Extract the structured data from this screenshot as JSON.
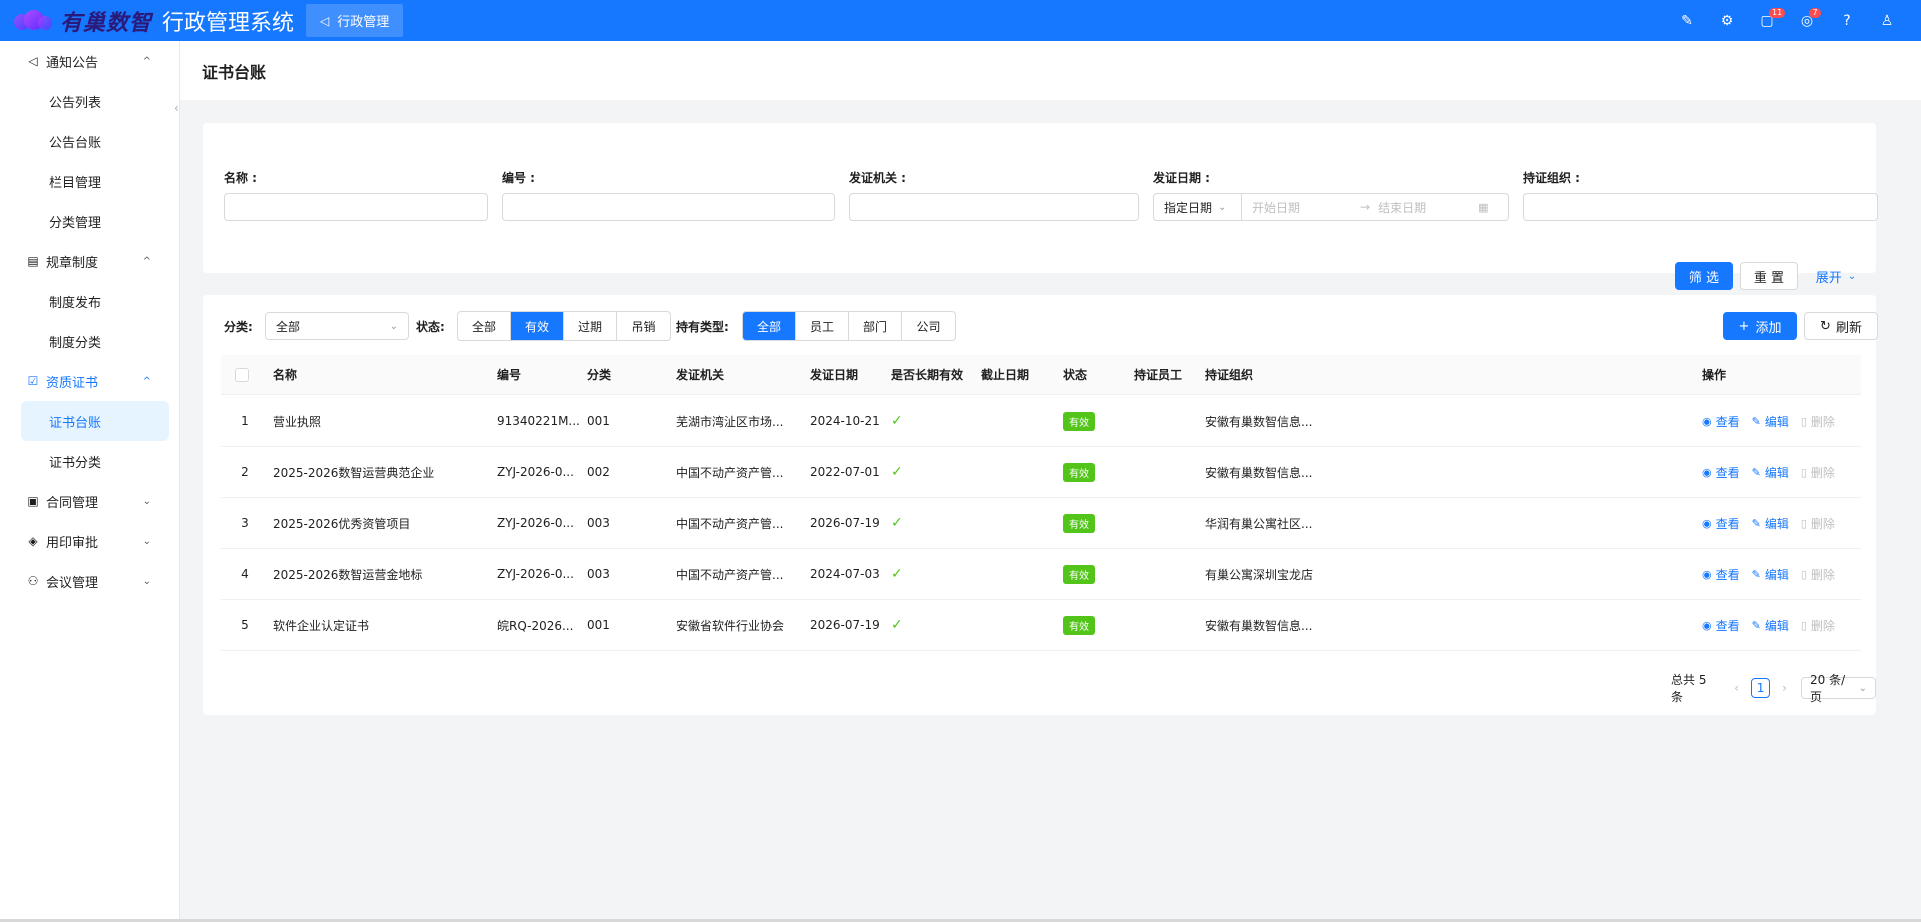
{
  "header": {
    "logo_text": "有巢数智",
    "system_title": "行政管理系统",
    "tab_label": "行政管理",
    "badges": {
      "notifications": "11",
      "tasks": "7"
    }
  },
  "sidebar": {
    "groups": [
      {
        "label": "通知公告",
        "icon": "megaphone-icon",
        "items": [
          "公告列表",
          "公告台账",
          "栏目管理",
          "分类管理"
        ]
      },
      {
        "label": "规章制度",
        "icon": "document-icon",
        "items": [
          "制度发布",
          "制度分类"
        ]
      },
      {
        "label": "资质证书",
        "icon": "certificate-icon",
        "items": [
          "证书台账",
          "证书分类"
        ]
      },
      {
        "label": "合同管理",
        "icon": "contract-icon"
      },
      {
        "label": "用印审批",
        "icon": "seal-icon"
      },
      {
        "label": "会议管理",
        "icon": "meeting-icon"
      }
    ],
    "active_item": "证书台账"
  },
  "page": {
    "title": "证书台账"
  },
  "filters": {
    "name_label": "名称 :",
    "number_label": "编号 :",
    "issuer_label": "发证机关 :",
    "issue_date_label": "发证日期 :",
    "date_mode": "指定日期",
    "start_placeholder": "开始日期",
    "end_placeholder": "结束日期",
    "holder_org_label": "持证组织 :",
    "filter_button": "筛 选",
    "reset_button": "重 置",
    "expand_button": "展开"
  },
  "toolbar": {
    "category_label": "分类:",
    "category_value": "全部",
    "status_label": "状态:",
    "status_options": [
      "全部",
      "有效",
      "过期",
      "吊销"
    ],
    "status_selected": "有效",
    "holder_type_label": "持有类型:",
    "holder_type_options": [
      "全部",
      "员工",
      "部门",
      "公司"
    ],
    "holder_type_selected": "全部",
    "add_button": "添加",
    "refresh_button": "刷新"
  },
  "table": {
    "columns": [
      "名称",
      "编号",
      "分类",
      "发证机关",
      "发证日期",
      "是否长期有效",
      "截止日期",
      "状态",
      "持证员工",
      "持证组织",
      "操作"
    ],
    "rows": [
      {
        "index": "1",
        "name": "营业执照",
        "number": "91340221M...",
        "category": "001",
        "issuer": "芜湖市湾沚区市场...",
        "issue_date": "2024-10-21",
        "long_term": "✓",
        "end_date": "",
        "status": "有效",
        "holder_employee": "",
        "holder_org": "安徽有巢数智信息..."
      },
      {
        "index": "2",
        "name": "2025-2026数智运营典范企业",
        "number": "ZYJ-2026-0...",
        "category": "002",
        "issuer": "中国不动产资产管...",
        "issue_date": "2022-07-01",
        "long_term": "✓",
        "end_date": "",
        "status": "有效",
        "holder_employee": "",
        "holder_org": "安徽有巢数智信息..."
      },
      {
        "index": "3",
        "name": "2025-2026优秀资管项目",
        "number": "ZYJ-2026-0...",
        "category": "003",
        "issuer": "中国不动产资产管...",
        "issue_date": "2026-07-19",
        "long_term": "✓",
        "end_date": "",
        "status": "有效",
        "holder_employee": "",
        "holder_org": "华润有巢公寓社区..."
      },
      {
        "index": "4",
        "name": "2025-2026数智运营金地标",
        "number": "ZYJ-2026-0...",
        "category": "003",
        "issuer": "中国不动产资产管...",
        "issue_date": "2024-07-03",
        "long_term": "✓",
        "end_date": "",
        "status": "有效",
        "holder_employee": "",
        "holder_org": "有巢公寓深圳宝龙店"
      },
      {
        "index": "5",
        "name": "软件企业认定证书",
        "number": "皖RQ-2026...",
        "category": "001",
        "issuer": "安徽省软件行业协会",
        "issue_date": "2026-07-19",
        "long_term": "✓",
        "end_date": "",
        "status": "有效",
        "holder_employee": "",
        "holder_org": "安徽有巢数智信息..."
      }
    ],
    "actions": {
      "view": "查看",
      "edit": "编辑",
      "delete": "删除"
    }
  },
  "pagination": {
    "total_text": "总共 5 条",
    "current_page": "1",
    "page_size": "20 条/页"
  },
  "colors": {
    "primary": "#1677ff",
    "success": "#52c41a",
    "danger": "#ff4d4f"
  }
}
